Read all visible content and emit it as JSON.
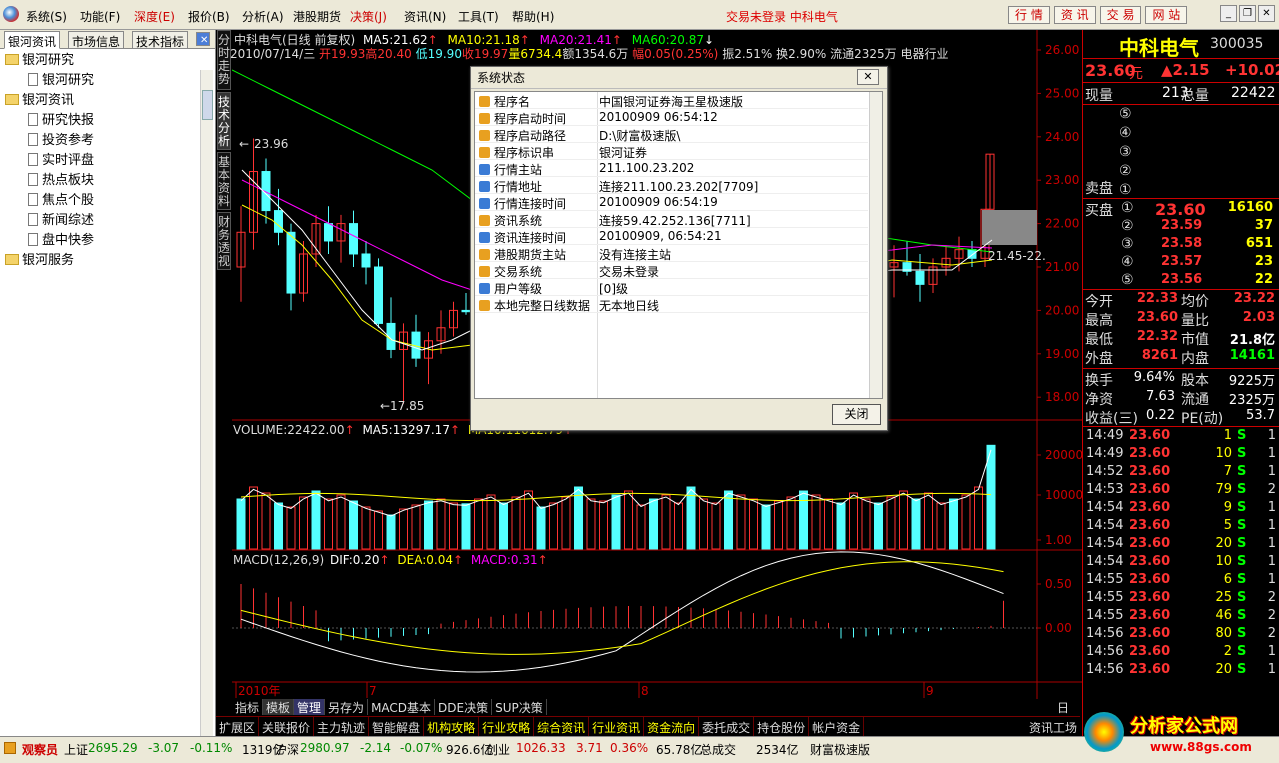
{
  "menu": {
    "items": [
      "系统(S)",
      "功能(F)",
      "深度(E)",
      "报价(B)",
      "分析(A)",
      "港股期货",
      "决策(J)",
      "资讯(N)",
      "工具(T)",
      "帮助(H)"
    ],
    "status": "交易未登录  中科电气",
    "buttons": [
      "行 情",
      "资 讯",
      "交 易",
      "网 站"
    ]
  },
  "left": {
    "tabs": [
      "银河资讯",
      "市场信息",
      "技术指标"
    ],
    "tree": [
      {
        "label": "银河研究",
        "level": 0
      },
      {
        "label": "银河研究",
        "level": 1
      },
      {
        "label": "银河资讯",
        "level": 0
      },
      {
        "label": "研究快报",
        "level": 1
      },
      {
        "label": "投资参考",
        "level": 1
      },
      {
        "label": "实时评盘",
        "level": 1
      },
      {
        "label": "热点板块",
        "level": 1
      },
      {
        "label": "焦点个股",
        "level": 1
      },
      {
        "label": "新闻综述",
        "level": 1
      },
      {
        "label": "盘中快参",
        "level": 1
      },
      {
        "label": "银河服务",
        "level": 0
      }
    ]
  },
  "vtabs": [
    "分时走势",
    "技术分析",
    "基本资料",
    "财务透视"
  ],
  "chart": {
    "line1": {
      "name": "中科电气(日线 前复权)",
      "ma5": "MA5:21.62",
      "ma10": "MA10:21.18",
      "ma20": "MA20:21.41",
      "ma60": "MA60:20.87"
    },
    "line2": {
      "date": "2010/07/14/三",
      "open": "开19.93",
      "high": "高20.40",
      "low": "低19.90",
      "close": "收19.97",
      "vol": "量6734.4",
      "amt": "额1354.6万",
      "chg": "幅0.05(0.25%)",
      "amp": "振2.51%",
      "turn": "换2.90%",
      "float": "流通2325万",
      "ind": "电器行业"
    },
    "hi_label": "23.96",
    "lo_label": "17.85",
    "right_label": "21.45-22.",
    "price_ticks": [
      "26.00",
      "25.00",
      "24.00",
      "23.00",
      "22.00",
      "21.00",
      "20.00",
      "19.00",
      "18.00"
    ],
    "vol_info": {
      "vol": "VOLUME:22422.00",
      "ma5": "MA5:13297.17",
      "ma10": "MA10:11612.79"
    },
    "vol_ticks": [
      "20000",
      "10000"
    ],
    "macd_info": {
      "name": "MACD(12,26,9)",
      "dif": "DIF:0.20",
      "dea": "DEA:0.04",
      "macd": "MACD:0.31"
    },
    "macd_ticks": [
      "1.00",
      "0.50",
      "0.00"
    ],
    "time_labels": [
      "2010年",
      "7",
      "8",
      "9"
    ],
    "period": "日线"
  },
  "ind_tabs": [
    "指标",
    "模板",
    "管理",
    "另存为",
    "MACD基本",
    "DDE决策",
    "SUP决策"
  ],
  "bottom_tabs": [
    "扩展区",
    "关联报价",
    "主力轨迹",
    "智能解盘",
    "机构攻略",
    "行业攻略",
    "综合资讯",
    "行业资讯",
    "资金流向",
    "委托成交",
    "持仓股份",
    "帐户资金",
    "资讯工场"
  ],
  "quote": {
    "name": "中科电气",
    "code": "300035",
    "price": "23.60",
    "unit": "元",
    "change": "▲2.15",
    "pct": "+10.02",
    "cur_vol_label": "现量",
    "cur_vol": "213",
    "total_label": "总量",
    "total": "22422",
    "sell": [
      {
        "lvl": "⑤",
        "p": "",
        "v": ""
      },
      {
        "lvl": "④",
        "p": "",
        "v": ""
      },
      {
        "lvl": "③",
        "p": "",
        "v": ""
      },
      {
        "lvl": "②",
        "p": "",
        "v": ""
      },
      {
        "lvl": "①",
        "p": "",
        "v": ""
      }
    ],
    "sell_label": "卖盘",
    "buy_label": "买盘",
    "buy": [
      {
        "lvl": "①",
        "p": "23.60",
        "v": "16160"
      },
      {
        "lvl": "②",
        "p": "23.59",
        "v": "37"
      },
      {
        "lvl": "③",
        "p": "23.58",
        "v": "651"
      },
      {
        "lvl": "④",
        "p": "23.57",
        "v": "23"
      },
      {
        "lvl": "⑤",
        "p": "23.56",
        "v": "22"
      }
    ],
    "stats": [
      [
        "今开",
        "22.33",
        "均价",
        "23.22"
      ],
      [
        "最高",
        "23.60",
        "量比",
        "2.03"
      ],
      [
        "最低",
        "22.32",
        "市值",
        "21.8亿"
      ],
      [
        "外盘",
        "8261",
        "内盘",
        "14161"
      ]
    ],
    "stats2": [
      [
        "换手",
        "9.64%",
        "股本",
        "9225万"
      ],
      [
        "净资",
        "7.63",
        "流通",
        "2325万"
      ],
      [
        "收益(三)",
        "0.22",
        "PE(动)",
        "53.7"
      ]
    ],
    "ticks": [
      [
        "14:49",
        "23.60",
        "1",
        "S",
        "1"
      ],
      [
        "14:49",
        "23.60",
        "10",
        "S",
        "1"
      ],
      [
        "14:52",
        "23.60",
        "7",
        "S",
        "1"
      ],
      [
        "14:53",
        "23.60",
        "79",
        "S",
        "2"
      ],
      [
        "14:54",
        "23.60",
        "9",
        "S",
        "1"
      ],
      [
        "14:54",
        "23.60",
        "5",
        "S",
        "1"
      ],
      [
        "14:54",
        "23.60",
        "20",
        "S",
        "1"
      ],
      [
        "14:54",
        "23.60",
        "10",
        "S",
        "1"
      ],
      [
        "14:55",
        "23.60",
        "6",
        "S",
        "1"
      ],
      [
        "14:55",
        "23.60",
        "25",
        "S",
        "2"
      ],
      [
        "14:55",
        "23.60",
        "46",
        "S",
        "2"
      ],
      [
        "14:56",
        "23.60",
        "80",
        "S",
        "2"
      ],
      [
        "14:56",
        "23.60",
        "2",
        "S",
        "1"
      ],
      [
        "14:56",
        "23.60",
        "20",
        "S",
        "1"
      ]
    ]
  },
  "dialog": {
    "title": "系统状态",
    "rows": [
      [
        "程序名",
        "中国银河证券海王星极速版"
      ],
      [
        "程序启动时间",
        "20100909 06:54:12"
      ],
      [
        "程序启动路径",
        "D:\\财富极速版\\"
      ],
      [
        "程序标识串",
        "银河证券"
      ],
      [
        "行情主站",
        "211.100.23.202"
      ],
      [
        "行情地址",
        "连接211.100.23.202[7709]"
      ],
      [
        "行情连接时间",
        "20100909 06:54:19"
      ],
      [
        "资讯系统",
        "连接59.42.252.136[7711]"
      ],
      [
        "资讯连接时间",
        "20100909, 06:54:21"
      ],
      [
        "港股期货主站",
        "没有连接主站"
      ],
      [
        "交易系统",
        "交易未登录"
      ],
      [
        "用户等级",
        "[0]级"
      ],
      [
        "本地完整日线数据",
        "无本地日线"
      ]
    ],
    "close": "关闭"
  },
  "statusbar": {
    "watcher": "观察员",
    "sh_name": "上证",
    "sh_idx": "2695.29",
    "sh_chg": "-3.07",
    "sh_pct": "-0.11%",
    "sh_amt": "1319亿",
    "sz_name": "沪深",
    "sz_idx": "2980.97",
    "sz_chg": "-2.14",
    "sz_pct": "-0.07%",
    "sz_amt": "926.6亿",
    "cy_name": "创业",
    "cy_idx": "1026.33",
    "cy_chg": "3.71",
    "cy_pct": "0.36%",
    "cy_amt": "65.78亿",
    "total_label": "总成交",
    "total": "2534亿",
    "app": "财富极速版"
  },
  "watermark": {
    "site": "分析家公式网",
    "url": "www.88gs.com"
  },
  "colors": {
    "up": "#ff3232",
    "down": "#54ffff",
    "ma5": "#ffffff",
    "ma10": "#ffff00",
    "ma20": "#ff00ff",
    "ma60": "#00ff00"
  }
}
